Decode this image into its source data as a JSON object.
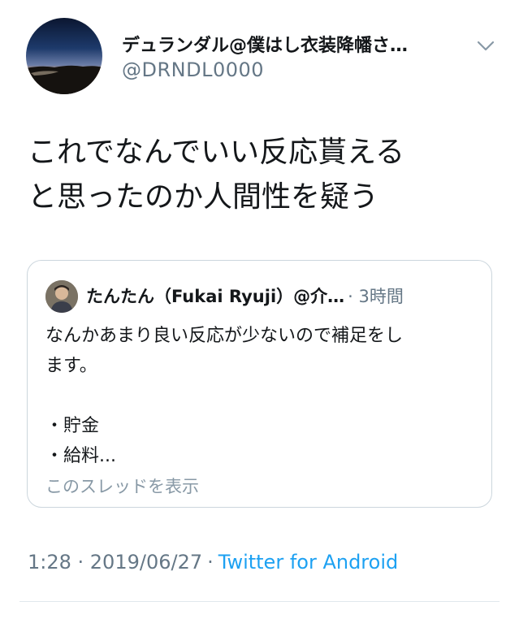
{
  "tweet": {
    "display_name": "デュランダル@僕はし衣装降幡さ…",
    "handle": "@DRNDL0000",
    "text": "これでなんでいい反応貰える\nと思ったのか人間性を疑う",
    "timestamp": "1:28 · 2019/06/27",
    "separator": "·",
    "source": "Twitter for Android",
    "more_icon": "chevron-down-icon"
  },
  "quoted": {
    "name": "たんたん（Fukai Ryuji）@介…",
    "time": "· 3時間",
    "text": "なんかあまり良い反応が少ないので補足をし\nます。\n\n・貯金\n・給料...",
    "show_thread": "このスレッドを表示"
  },
  "colors": {
    "text": "#14171a",
    "secondary": "#657786",
    "link": "#1da1f2",
    "border": "#ccd6dd"
  }
}
